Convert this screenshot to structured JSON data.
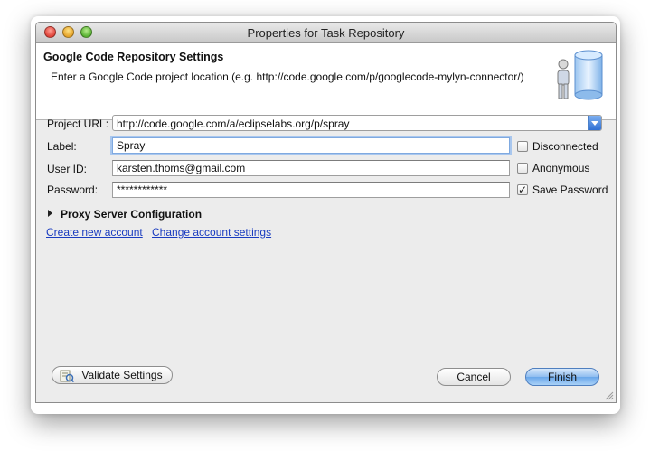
{
  "window": {
    "title": "Properties for Task Repository"
  },
  "header": {
    "title": "Google Code Repository Settings",
    "description": "Enter a Google Code project location (e.g. http://code.google.com/p/googlecode-mylyn-connector/)",
    "icon": "repository-database-icon"
  },
  "form": {
    "project_url": {
      "label": "Project URL:",
      "value": "http://code.google.com/a/eclipselabs.org/p/spray"
    },
    "label": {
      "label": "Label:",
      "value": "Spray"
    },
    "user_id": {
      "label": "User ID:",
      "value": "karsten.thoms@gmail.com"
    },
    "password": {
      "label": "Password:",
      "value": "************"
    }
  },
  "options": {
    "disconnected": {
      "label": "Disconnected",
      "checked": false
    },
    "anonymous": {
      "label": "Anonymous",
      "checked": false
    },
    "save_password": {
      "label": "Save Password",
      "checked": true,
      "mark": "✓"
    }
  },
  "proxy": {
    "label": "Proxy Server Configuration",
    "expanded": false
  },
  "links": {
    "create_account": "Create new account",
    "change_account": "Change account settings"
  },
  "buttons": {
    "validate": "Validate Settings",
    "cancel": "Cancel",
    "finish": "Finish"
  },
  "colors": {
    "link": "#1a3cc0",
    "focus_ring": "#a9c7ee",
    "primary_button": "#6aa7ea"
  }
}
